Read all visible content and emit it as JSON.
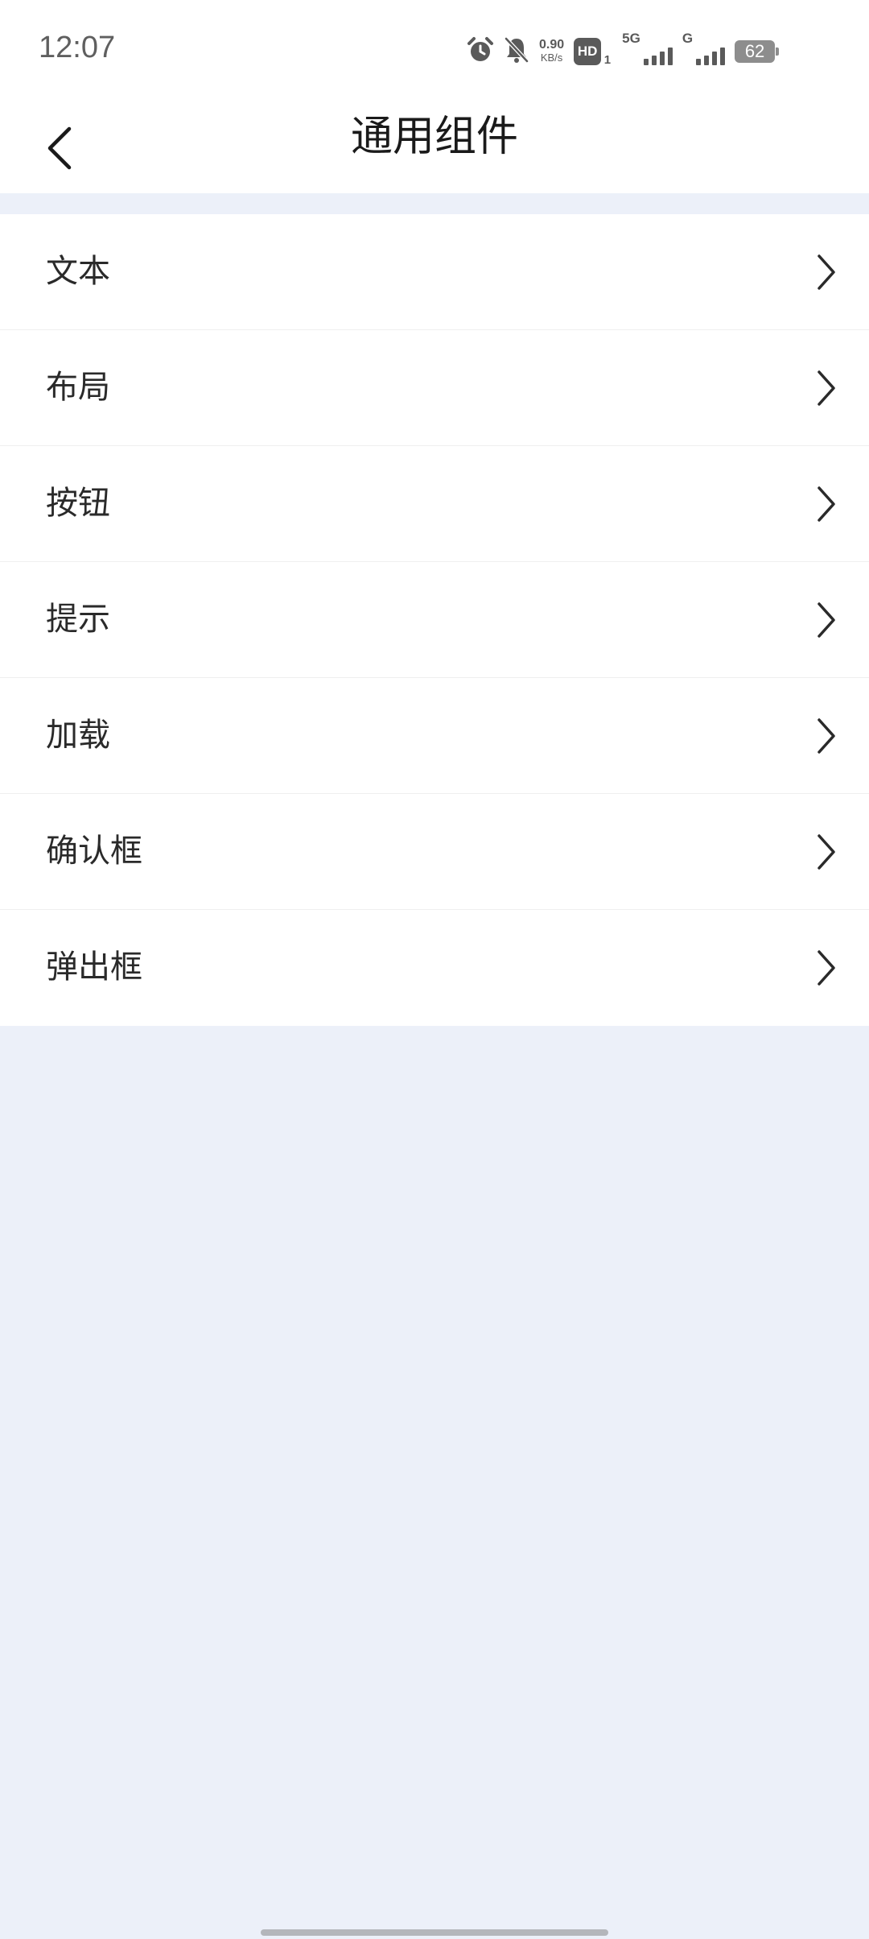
{
  "status_bar": {
    "time": "12:07",
    "net_speed_value": "0.90",
    "net_speed_unit": "KB/s",
    "hd_label": "HD",
    "hd_sub": "1",
    "net_5g": "5G",
    "net_g": "G",
    "battery": "62",
    "icons": [
      "alarm-icon",
      "bell-off-icon",
      "signal-icon",
      "battery-icon"
    ]
  },
  "header": {
    "title": "通用组件",
    "back_icon": "chevron-left-icon"
  },
  "menu": {
    "items": [
      {
        "label": "文本"
      },
      {
        "label": "布局"
      },
      {
        "label": "按钮"
      },
      {
        "label": "提示"
      },
      {
        "label": "加载"
      },
      {
        "label": "确认框"
      },
      {
        "label": "弹出框"
      }
    ],
    "item_icon": "chevron-right-icon"
  },
  "colors": {
    "background": "#ecf0f9",
    "surface": "#ffffff",
    "text": "#2a2a2a",
    "title": "#1a1a1a",
    "divider": "#efefef"
  }
}
